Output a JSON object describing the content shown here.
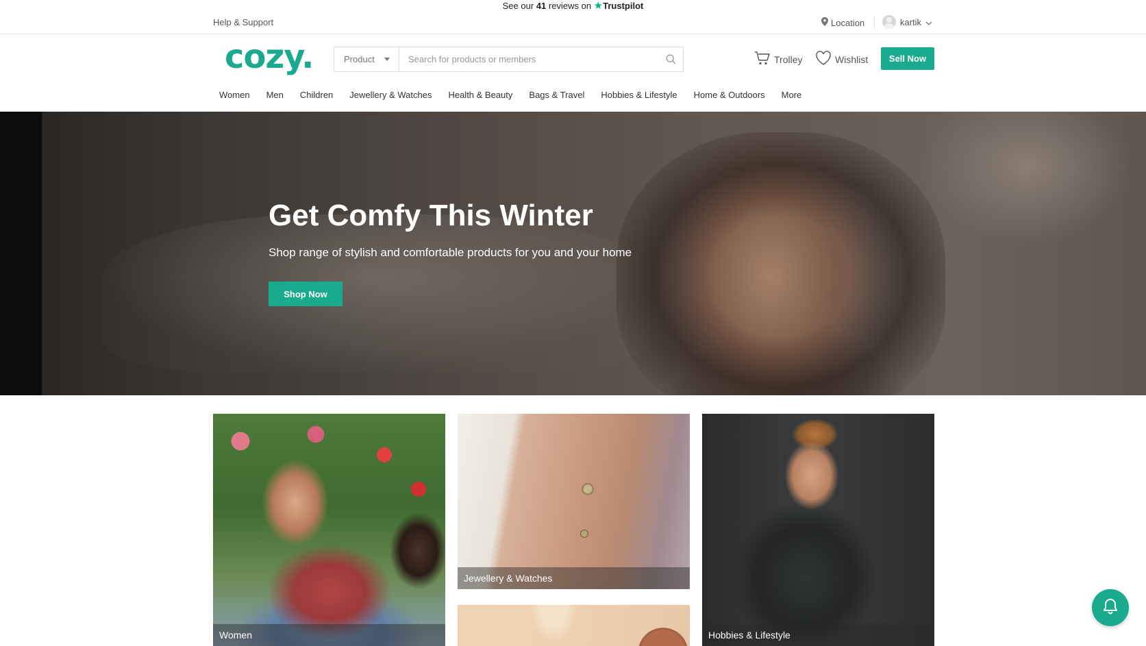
{
  "trustpilot": {
    "prefix": "See our",
    "count": "41",
    "suffix": "reviews on",
    "brand": "Trustpilot"
  },
  "utility": {
    "help": "Help & Support",
    "location": "Location",
    "username": "kartik"
  },
  "header": {
    "logo": "cozy.",
    "product_select": "Product",
    "search_placeholder": "Search for products or members",
    "trolley": "Trolley",
    "wishlist": "Wishlist",
    "sell_now": "Sell Now"
  },
  "nav": [
    "Women",
    "Men",
    "Children",
    "Jewellery & Watches",
    "Health & Beauty",
    "Bags & Travel",
    "Hobbies & Lifestyle",
    "Home & Outdoors",
    "More"
  ],
  "hero": {
    "title": "Get Comfy This Winter",
    "subtitle": "Shop range of stylish and comfortable products for you and your home",
    "button": "Shop Now"
  },
  "tiles": {
    "women": "Women",
    "jewellery": "Jewellery & Watches",
    "hobbies": "Hobbies & Lifestyle"
  },
  "colors": {
    "accent": "#1aaa8e",
    "trustpilot_star": "#00b67a"
  },
  "icons": {
    "location": "location-pin-icon",
    "user_caret": "chevron-down-icon",
    "search": "search-icon",
    "trolley": "cart-icon",
    "wishlist": "heart-icon",
    "chat": "bell-icon"
  }
}
